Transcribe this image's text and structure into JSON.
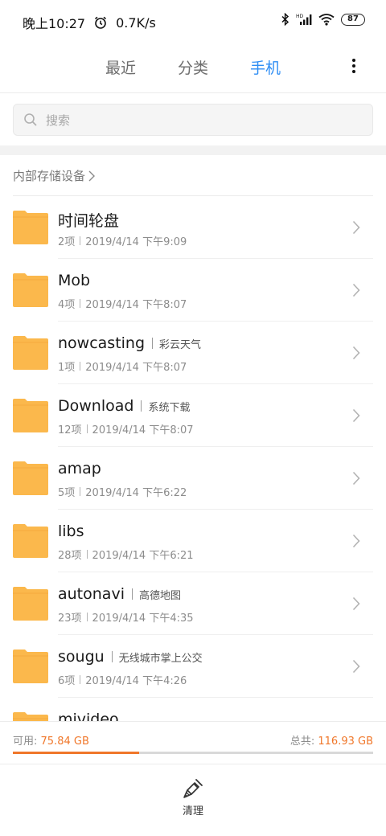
{
  "status_bar": {
    "time": "晚上10:27",
    "speed": "0.7K/s",
    "battery": "87",
    "network_label": "HD"
  },
  "tabs": [
    {
      "label": "最近",
      "active": false
    },
    {
      "label": "分类",
      "active": false
    },
    {
      "label": "手机",
      "active": true
    }
  ],
  "search": {
    "placeholder": "搜索"
  },
  "breadcrumb": "内部存储设备",
  "folders": [
    {
      "name": "时间轮盘",
      "tag": "",
      "count": "2项",
      "date": "2019/4/14 下午9:09"
    },
    {
      "name": "Mob",
      "tag": "",
      "count": "4项",
      "date": "2019/4/14 下午8:07"
    },
    {
      "name": "nowcasting",
      "tag": "彩云天气",
      "count": "1项",
      "date": "2019/4/14 下午8:07"
    },
    {
      "name": "Download",
      "tag": "系统下载",
      "count": "12项",
      "date": "2019/4/14 下午8:07"
    },
    {
      "name": "amap",
      "tag": "",
      "count": "5项",
      "date": "2019/4/14 下午6:22"
    },
    {
      "name": "libs",
      "tag": "",
      "count": "28项",
      "date": "2019/4/14 下午6:21"
    },
    {
      "name": "autonavi",
      "tag": "高德地图",
      "count": "23项",
      "date": "2019/4/14 下午4:35"
    },
    {
      "name": "sougu",
      "tag": "无线城市掌上公交",
      "count": "6项",
      "date": "2019/4/14 下午4:26"
    },
    {
      "name": "mivideo",
      "tag": "",
      "count": "",
      "date": ""
    }
  ],
  "storage": {
    "used_label": "可用: ",
    "used_value": "75.84 GB",
    "total_label": "总共: ",
    "total_value": "116.93 GB",
    "fill_fraction": 0.35
  },
  "bottom": {
    "clean_label": "清理"
  },
  "colors": {
    "accent": "#2f8ef4",
    "folder": "#fbb84c",
    "storage": "#f0772a"
  }
}
